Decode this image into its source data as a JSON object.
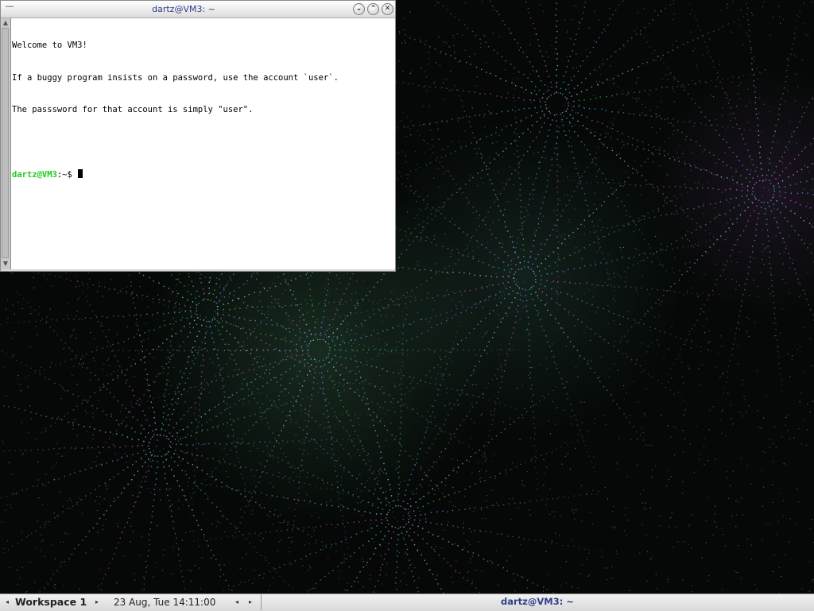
{
  "terminal": {
    "title": "dartz@VM3: ~",
    "menu_glyph": "—",
    "buttons": {
      "minimize_glyph": "⌄",
      "maximize_glyph": "⌃",
      "close_glyph": "✕"
    },
    "lines": [
      "Welcome to VM3!",
      "If a buggy program insists on a password, use the account `user`.",
      "The passsword for that account is simply \"user\".",
      ""
    ],
    "prompt": {
      "user_host": "dartz@VM3",
      "path_and_symbol": ":~$ "
    },
    "colors": {
      "prompt_user": "#22cc22",
      "title_text": "#2f3f8a",
      "background": "#ffffff"
    }
  },
  "taskbar": {
    "workspace_label": "Workspace 1",
    "clock_label": "23 Aug, Tue 14:11:00",
    "task_label": "dartz@VM3: ~",
    "left_arrow": "◂",
    "right_arrow": "▸"
  },
  "wallpaper": {
    "colors": [
      "#3fbf6a",
      "#5a9fff",
      "#c060c0",
      "#9fd0ff"
    ]
  }
}
